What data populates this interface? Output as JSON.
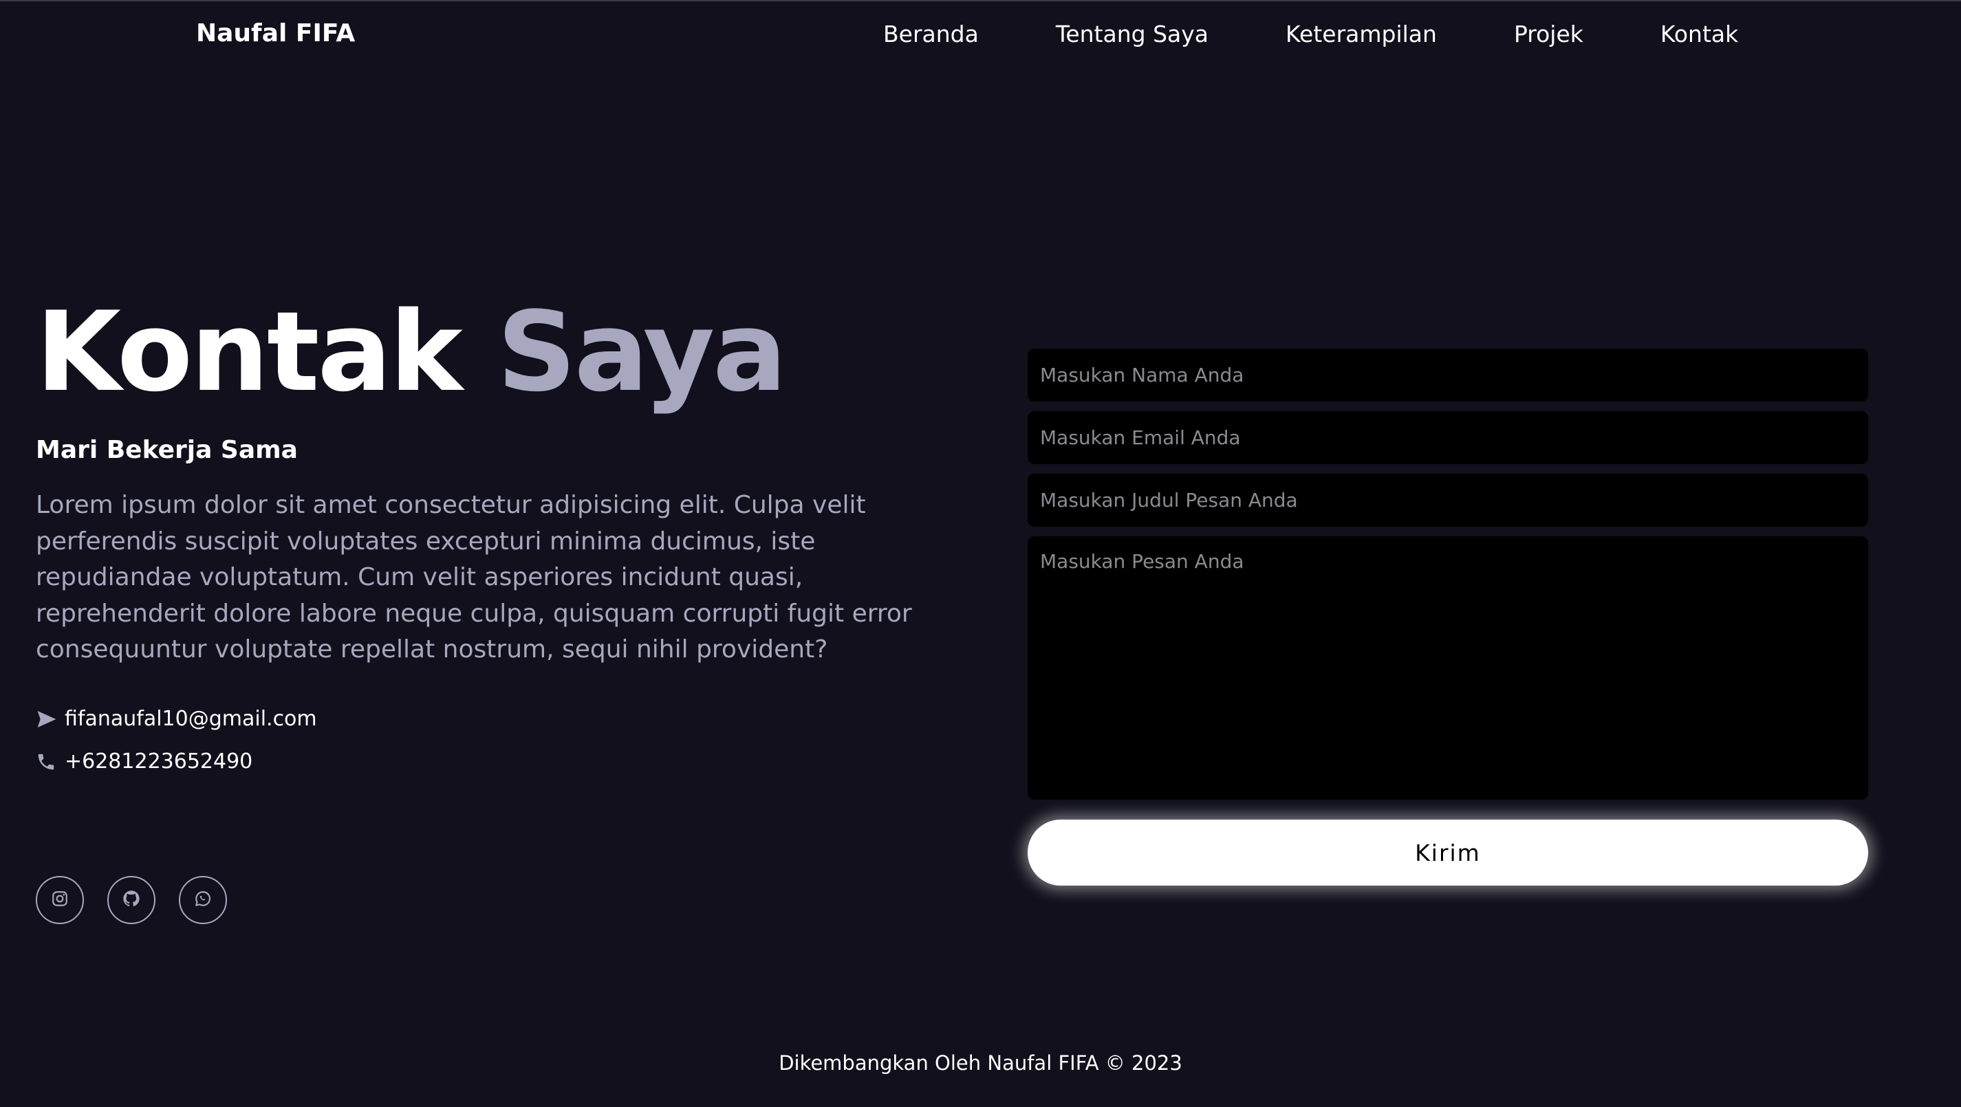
{
  "header": {
    "brand": "Naufal FIFA",
    "nav": [
      {
        "label": "Beranda"
      },
      {
        "label": "Tentang Saya"
      },
      {
        "label": "Keterampilan"
      },
      {
        "label": "Projek"
      },
      {
        "label": "Kontak"
      }
    ]
  },
  "contact": {
    "title_part1": "Kontak",
    "title_part2": "Saya",
    "subtitle": "Mari Bekerja Sama",
    "description": "Lorem ipsum dolor sit amet consectetur adipisicing elit. Culpa velit perferendis suscipit voluptates excepturi minima ducimus, iste repudiandae voluptatum. Cum velit asperiores incidunt quasi, reprehenderit dolore labore neque culpa, quisquam corrupti fugit error consequuntur voluptate repellat nostrum, sequi nihil provident?",
    "email": "fifanaufal10@gmail.com",
    "phone": "+6281223652490",
    "email_icon": "send-icon",
    "phone_icon": "phone-icon",
    "socials": [
      {
        "icon": "instagram-icon"
      },
      {
        "icon": "github-icon"
      },
      {
        "icon": "whatsapp-icon"
      }
    ]
  },
  "form": {
    "name_placeholder": "Masukan Nama Anda",
    "email_placeholder": "Masukan Email Anda",
    "subject_placeholder": "Masukan Judul Pesan Anda",
    "message_placeholder": "Masukan Pesan Anda",
    "submit_label": "Kirim"
  },
  "footer": {
    "text": "Dikembangkan Oleh Naufal FIFA © 2023"
  },
  "colors": {
    "background": "#11101c",
    "accent_text": "#a7a8bf",
    "input_bg": "#000000",
    "button_bg": "#ffffff"
  }
}
